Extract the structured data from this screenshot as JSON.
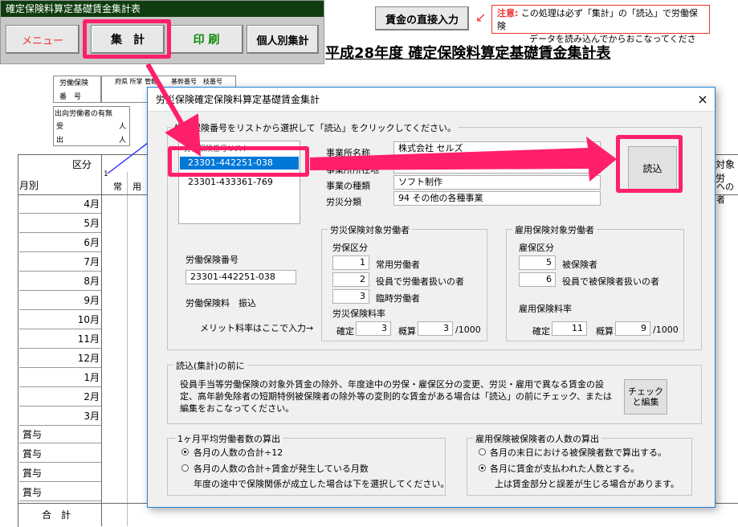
{
  "toolbar": {
    "title": "確定保険料算定基礎賃金集計表",
    "menu": "メニュー",
    "aggregate": "集　計",
    "print": "印 刷",
    "individual": "個人別集計"
  },
  "direct_button": "賃金の直接入力",
  "notice": {
    "label": "注意:",
    "line1": "この処理は必ず「集計」の「読込」で労働保険",
    "line2": "データを読み込んでからおこなってください。"
  },
  "sheet": {
    "title": "平成28年度 確定保険料算定基礎賃金集計表",
    "labor_ins": "労働保険",
    "number": "番　号",
    "codes": "府県 所掌 管轄",
    "base_no": "基幹番号　枝番号",
    "transfer": "出向労働者の有無",
    "receive": "受",
    "send": "出",
    "person": "人",
    "kubun": "区分",
    "getsubetsu": "月別",
    "jo": "常",
    "yo": "用",
    "one": "1",
    "taisho": "対象労",
    "nomono": "への者",
    "months": [
      "4月",
      "5月",
      "6月",
      "7月",
      "8月",
      "9月",
      "10月",
      "11月",
      "12月",
      "1月",
      "2月",
      "3月"
    ],
    "bonus": [
      "賞与",
      "賞与",
      "賞与",
      "賞与"
    ],
    "total": "合　計"
  },
  "dialog": {
    "title": "労災保険確定保険料算定基礎賃金集計",
    "close": "×",
    "list_group": "労働保険番号をリストから選択して「読込」をクリックしてください。",
    "list_header": "労働保険番号リスト",
    "list": [
      "23301-442251-038",
      "23301-433361-769"
    ],
    "selected_index": 0,
    "office_name_label": "事業所名称",
    "office_name": "株式会社 セルズ",
    "office_addr_label": "事業所所在地",
    "office_addr": "",
    "business_label": "事業の種類",
    "business": "ソフト制作",
    "rosai_cat_label": "労災分類",
    "rosai_cat": "94 その他の各種事業",
    "load_button": "読込",
    "labor_no_label": "労働保険番号",
    "labor_no": "23301-442251-038",
    "rate_label": "労働保険料　振込",
    "merit_label": "メリット料率はここで入力→",
    "rosai_group": "労災保険対象労働者",
    "rosai_kubun": "労保区分",
    "rosai_items": [
      {
        "code": "1",
        "label": "常用労働者"
      },
      {
        "code": "2",
        "label": "役員で労働者扱いの者"
      },
      {
        "code": "3",
        "label": "臨時労働者"
      }
    ],
    "rosai_rate_label": "労災保険料率",
    "kakutei": "確定",
    "gaisan": "概算",
    "rosai_kakutei": "3",
    "rosai_gaisan": "3",
    "per1000": "/1000",
    "koyo_group": "雇用保険対象労働者",
    "koyo_kubun": "雇保区分",
    "koyo_items": [
      {
        "code": "5",
        "label": "被保険者"
      },
      {
        "code": "6",
        "label": "役員で被保険者扱いの者"
      }
    ],
    "koyo_rate_label": "雇用保険料率",
    "koyo_kakutei": "11",
    "koyo_gaisan": "9",
    "before_group": "読込(集計)の前に",
    "before_text": "役員手当等労働保険の対象外賃金の除外、年度途中の労保・雇保区分の変更、労災・雇用で異なる賃金の設定、高年齢免除者の短期特例被保険者の除外等の変則的な賃金がある場合は「読込」の前にチェック、または編集をおこなってください。",
    "check_button_1": "チェック",
    "check_button_2": "と編集",
    "avg_group": "1ヶ月平均労働者数の算出",
    "avg_opt1": "各月の人数の合計÷12",
    "avg_opt2": "各月の人数の合計÷賃金が発生している月数",
    "avg_note": "年度の途中で保険関係が成立した場合は下を選択してください。",
    "koyo_count_group": "雇用保険被保険者の人数の算出",
    "koyo_opt1": "各月の末日における被保険者数で算出する。",
    "koyo_opt2": "各月に賃金が支払われた人数とする。",
    "koyo_note": "上は賃金部分と誤差が生じる場合があります。"
  }
}
